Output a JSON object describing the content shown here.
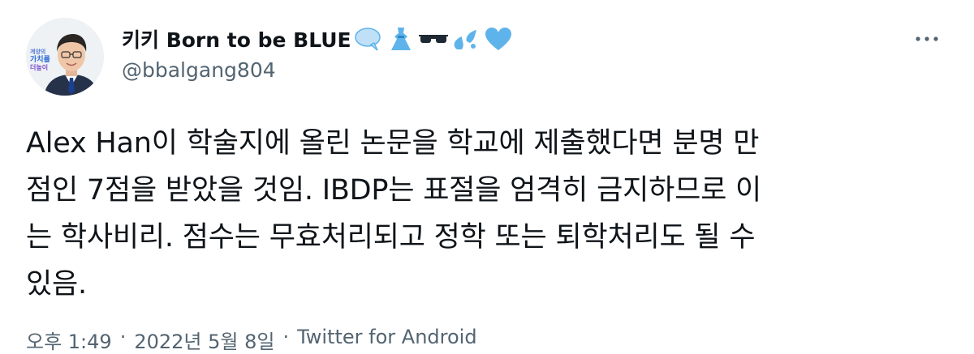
{
  "author": {
    "display_name": "키키 Born to be BLUE",
    "emoji_icons": [
      "speech-bubble-icon",
      "dress-icon",
      "sunglasses-icon",
      "sweat-droplets-icon",
      "blue-heart-icon"
    ],
    "handle": "@bbalgang804",
    "avatar_badge_text": "계양의 가치를 더높이"
  },
  "menu": {
    "more_icon": "more-options-icon"
  },
  "tweet": {
    "text": "Alex Han이 학술지에 올린 논문을 학교에 제출했다면 분명 만\n점인 7점을 받았을 것임. IBDP는 표절을 엄격히 금지하므로 이\n는 학사비리. 점수는 무효처리되고 정학 또는 퇴학처리도 될 수\n있음."
  },
  "meta": {
    "time": "오후 1:49",
    "separator1": "·",
    "date": "2022년 5월 8일",
    "separator2": "·",
    "source": "Twitter for Android"
  },
  "colors": {
    "text_primary": "#0f1419",
    "text_secondary": "#536471",
    "emoji_blue": "#5eb4ea"
  }
}
